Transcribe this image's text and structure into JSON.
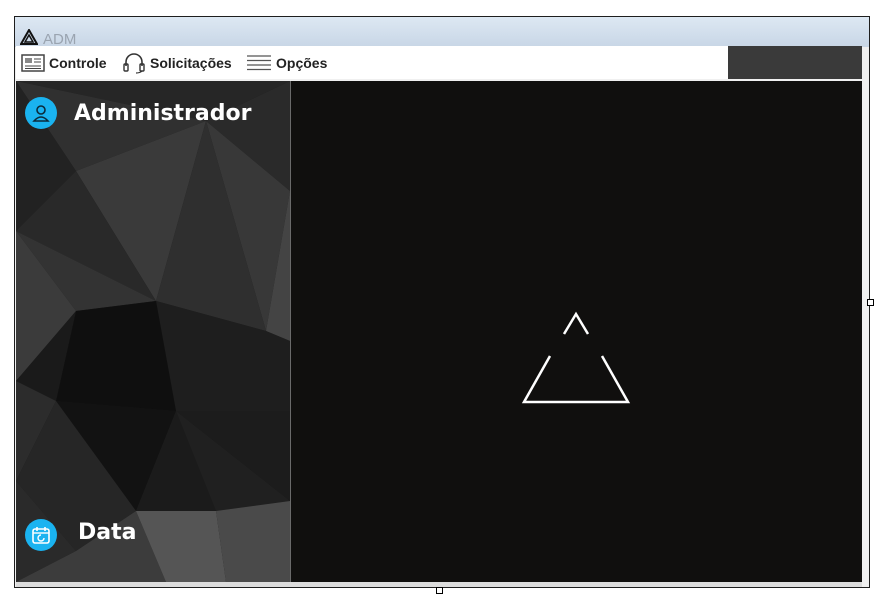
{
  "window": {
    "title": "ADM",
    "icon": "triangle-logo-icon"
  },
  "menu": {
    "items": [
      {
        "label": "Controle",
        "icon": "control-panel-icon"
      },
      {
        "label": "Solicitações",
        "icon": "headset-icon"
      },
      {
        "label": "Opções",
        "icon": "menu-lines-icon"
      }
    ]
  },
  "sidebar": {
    "user_label": "Administrador",
    "user_icon": "user-icon",
    "date_label": "Data",
    "date_icon": "calendar-icon"
  },
  "main": {
    "logo_icon": "triangle-logo-icon"
  },
  "colors": {
    "accent": "#1ab3f0",
    "main_bg": "#100f0e",
    "sidebar_bg": "#151515",
    "titlebar": "#c8d6e6"
  }
}
